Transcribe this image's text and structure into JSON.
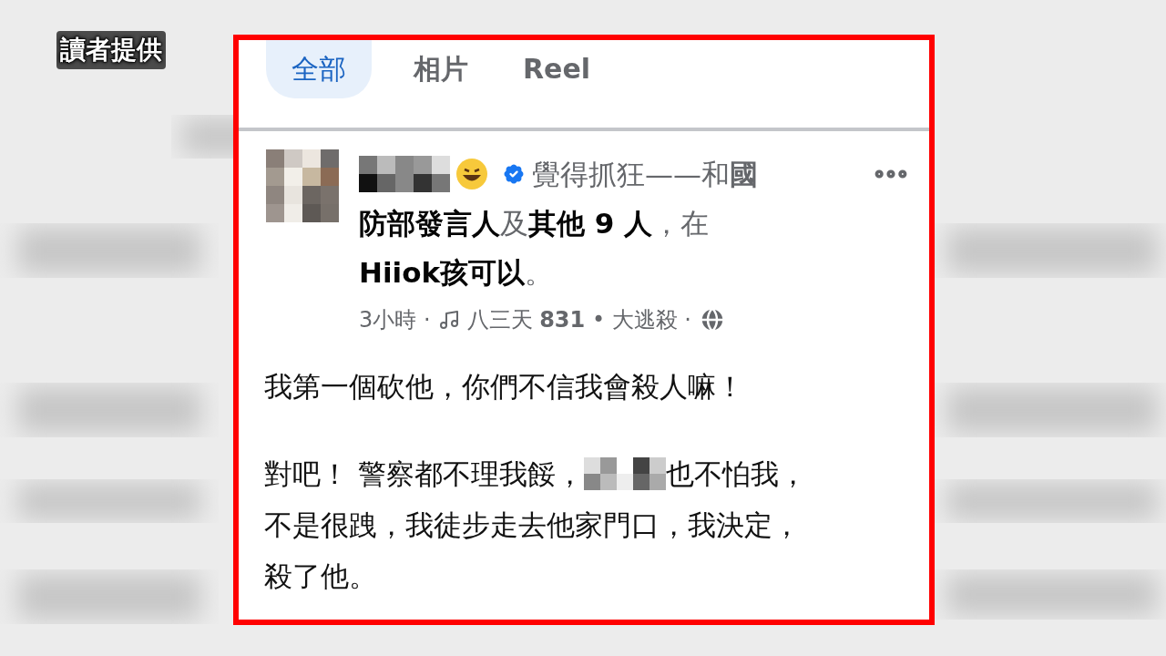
{
  "caption": "讀者提供",
  "tabs": [
    {
      "label": "全部",
      "selected": true
    },
    {
      "label": "相片",
      "selected": false
    },
    {
      "label": "Reel",
      "selected": false
    }
  ],
  "post": {
    "header_lines": [
      "覺得抓狂——和**國**",
      "**防部發言人**及**其他 9 人**，在",
      "**Hiiok孩可以**。"
    ],
    "time": "3小時 ·",
    "music": "八三天 **831** • 大逃殺 ·",
    "paragraphs": [
      [
        {
          "kind": "plain",
          "text": "我第一個砍他，你們不信我會殺人嘛！"
        }
      ],
      [
        {
          "kind": "censored",
          "before": "對吧！ 警察都不理我餒，",
          "after": "也不怕我，"
        },
        {
          "kind": "plain",
          "text": "不是很跩，我徒步走去他家門口，我決定，"
        },
        {
          "kind": "plain",
          "text": "殺了他。"
        }
      ]
    ]
  }
}
